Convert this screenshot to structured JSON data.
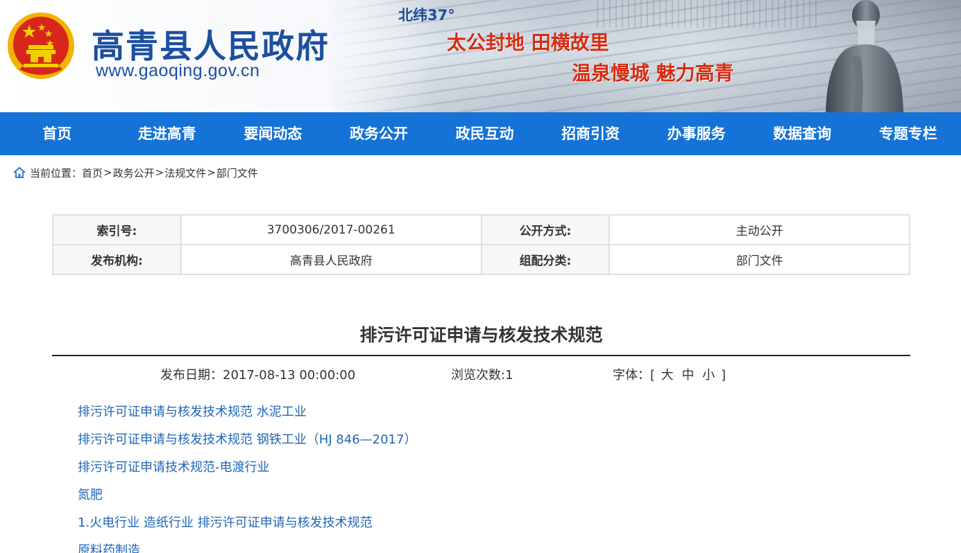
{
  "header": {
    "site_title": "高青县人民政府",
    "site_url": "www.gaoqing.gov.cn",
    "latitude": "北纬37°",
    "slogan_line1": "太公封地 田横故里",
    "slogan_line2": "温泉慢城 魅力高青",
    "colors": {
      "title": "#1c4fa0",
      "slogan": "#d82b12",
      "emblem_red": "#d7261b",
      "emblem_gold": "#f2b400"
    }
  },
  "nav": {
    "background": "#1572d6",
    "items": [
      {
        "label": "首页"
      },
      {
        "label": "走进高青"
      },
      {
        "label": "要闻动态"
      },
      {
        "label": "政务公开"
      },
      {
        "label": "政民互动"
      },
      {
        "label": "招商引资"
      },
      {
        "label": "办事服务"
      },
      {
        "label": "数据查询"
      },
      {
        "label": "专题专栏"
      }
    ]
  },
  "breadcrumb": {
    "prefix": "当前位置：",
    "icon": "home-icon",
    "items": [
      "首页",
      "政务公开",
      "法规文件",
      "部门文件"
    ],
    "separator": ">"
  },
  "meta": {
    "index_label": "索引号:",
    "index_value": "3700306/2017-00261",
    "disclosure_label": "公开方式:",
    "disclosure_value": "主动公开",
    "publisher_label": "发布机构:",
    "publisher_value": "高青县人民政府",
    "category_label": "组配分类:",
    "category_value": "部门文件"
  },
  "article": {
    "title": "排污许可证申请与核发技术规范",
    "date_text": "发布日期：2017-08-13 00:00:00",
    "views_text": "浏览次数:1",
    "font_label": "字体：[",
    "font_large": "大",
    "font_medium": "中",
    "font_small": "小",
    "font_close": "]",
    "links": [
      "排污许可证申请与核发技术规范 水泥工业",
      "排污许可证申请与核发技术规范 钢铁工业（HJ 846—2017）",
      "排污许可证申请技术规范-电渡行业",
      "氮肥",
      "1.火电行业 造纸行业 排污许可证申请与核发技术规范",
      "原料药制造"
    ],
    "link_color": "#2066b8"
  }
}
